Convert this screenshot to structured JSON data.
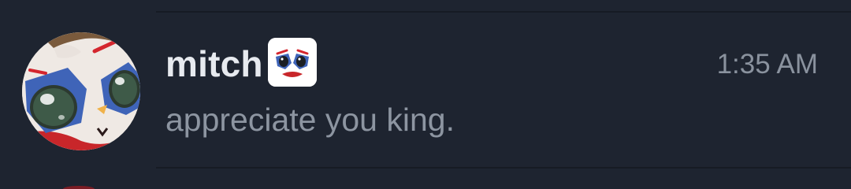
{
  "message": {
    "username": "mitch",
    "timestamp": "1:35 AM",
    "text": "appreciate you king.",
    "avatar_icon": "clown-doll-avatar-icon",
    "badge_icon": "clown-face-badge-icon"
  },
  "colors": {
    "background": "#1e2430",
    "divider": "#161b24",
    "username": "#e7eaef",
    "timestamp": "#8a929e",
    "message_text": "#8d95a1",
    "badge_background": "#ffffff"
  }
}
